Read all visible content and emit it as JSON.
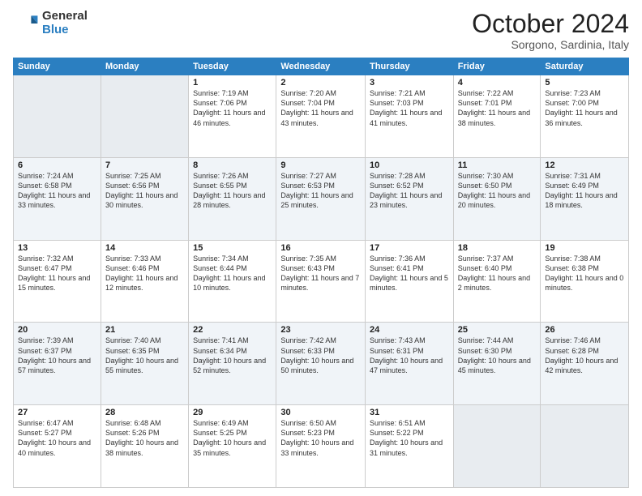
{
  "logo": {
    "general": "General",
    "blue": "Blue"
  },
  "header": {
    "month": "October 2024",
    "location": "Sorgono, Sardinia, Italy"
  },
  "weekdays": [
    "Sunday",
    "Monday",
    "Tuesday",
    "Wednesday",
    "Thursday",
    "Friday",
    "Saturday"
  ],
  "weeks": [
    [
      null,
      null,
      {
        "day": "1",
        "sunrise": "Sunrise: 7:19 AM",
        "sunset": "Sunset: 7:06 PM",
        "daylight": "Daylight: 11 hours and 46 minutes."
      },
      {
        "day": "2",
        "sunrise": "Sunrise: 7:20 AM",
        "sunset": "Sunset: 7:04 PM",
        "daylight": "Daylight: 11 hours and 43 minutes."
      },
      {
        "day": "3",
        "sunrise": "Sunrise: 7:21 AM",
        "sunset": "Sunset: 7:03 PM",
        "daylight": "Daylight: 11 hours and 41 minutes."
      },
      {
        "day": "4",
        "sunrise": "Sunrise: 7:22 AM",
        "sunset": "Sunset: 7:01 PM",
        "daylight": "Daylight: 11 hours and 38 minutes."
      },
      {
        "day": "5",
        "sunrise": "Sunrise: 7:23 AM",
        "sunset": "Sunset: 7:00 PM",
        "daylight": "Daylight: 11 hours and 36 minutes."
      }
    ],
    [
      {
        "day": "6",
        "sunrise": "Sunrise: 7:24 AM",
        "sunset": "Sunset: 6:58 PM",
        "daylight": "Daylight: 11 hours and 33 minutes."
      },
      {
        "day": "7",
        "sunrise": "Sunrise: 7:25 AM",
        "sunset": "Sunset: 6:56 PM",
        "daylight": "Daylight: 11 hours and 30 minutes."
      },
      {
        "day": "8",
        "sunrise": "Sunrise: 7:26 AM",
        "sunset": "Sunset: 6:55 PM",
        "daylight": "Daylight: 11 hours and 28 minutes."
      },
      {
        "day": "9",
        "sunrise": "Sunrise: 7:27 AM",
        "sunset": "Sunset: 6:53 PM",
        "daylight": "Daylight: 11 hours and 25 minutes."
      },
      {
        "day": "10",
        "sunrise": "Sunrise: 7:28 AM",
        "sunset": "Sunset: 6:52 PM",
        "daylight": "Daylight: 11 hours and 23 minutes."
      },
      {
        "day": "11",
        "sunrise": "Sunrise: 7:30 AM",
        "sunset": "Sunset: 6:50 PM",
        "daylight": "Daylight: 11 hours and 20 minutes."
      },
      {
        "day": "12",
        "sunrise": "Sunrise: 7:31 AM",
        "sunset": "Sunset: 6:49 PM",
        "daylight": "Daylight: 11 hours and 18 minutes."
      }
    ],
    [
      {
        "day": "13",
        "sunrise": "Sunrise: 7:32 AM",
        "sunset": "Sunset: 6:47 PM",
        "daylight": "Daylight: 11 hours and 15 minutes."
      },
      {
        "day": "14",
        "sunrise": "Sunrise: 7:33 AM",
        "sunset": "Sunset: 6:46 PM",
        "daylight": "Daylight: 11 hours and 12 minutes."
      },
      {
        "day": "15",
        "sunrise": "Sunrise: 7:34 AM",
        "sunset": "Sunset: 6:44 PM",
        "daylight": "Daylight: 11 hours and 10 minutes."
      },
      {
        "day": "16",
        "sunrise": "Sunrise: 7:35 AM",
        "sunset": "Sunset: 6:43 PM",
        "daylight": "Daylight: 11 hours and 7 minutes."
      },
      {
        "day": "17",
        "sunrise": "Sunrise: 7:36 AM",
        "sunset": "Sunset: 6:41 PM",
        "daylight": "Daylight: 11 hours and 5 minutes."
      },
      {
        "day": "18",
        "sunrise": "Sunrise: 7:37 AM",
        "sunset": "Sunset: 6:40 PM",
        "daylight": "Daylight: 11 hours and 2 minutes."
      },
      {
        "day": "19",
        "sunrise": "Sunrise: 7:38 AM",
        "sunset": "Sunset: 6:38 PM",
        "daylight": "Daylight: 11 hours and 0 minutes."
      }
    ],
    [
      {
        "day": "20",
        "sunrise": "Sunrise: 7:39 AM",
        "sunset": "Sunset: 6:37 PM",
        "daylight": "Daylight: 10 hours and 57 minutes."
      },
      {
        "day": "21",
        "sunrise": "Sunrise: 7:40 AM",
        "sunset": "Sunset: 6:35 PM",
        "daylight": "Daylight: 10 hours and 55 minutes."
      },
      {
        "day": "22",
        "sunrise": "Sunrise: 7:41 AM",
        "sunset": "Sunset: 6:34 PM",
        "daylight": "Daylight: 10 hours and 52 minutes."
      },
      {
        "day": "23",
        "sunrise": "Sunrise: 7:42 AM",
        "sunset": "Sunset: 6:33 PM",
        "daylight": "Daylight: 10 hours and 50 minutes."
      },
      {
        "day": "24",
        "sunrise": "Sunrise: 7:43 AM",
        "sunset": "Sunset: 6:31 PM",
        "daylight": "Daylight: 10 hours and 47 minutes."
      },
      {
        "day": "25",
        "sunrise": "Sunrise: 7:44 AM",
        "sunset": "Sunset: 6:30 PM",
        "daylight": "Daylight: 10 hours and 45 minutes."
      },
      {
        "day": "26",
        "sunrise": "Sunrise: 7:46 AM",
        "sunset": "Sunset: 6:28 PM",
        "daylight": "Daylight: 10 hours and 42 minutes."
      }
    ],
    [
      {
        "day": "27",
        "sunrise": "Sunrise: 6:47 AM",
        "sunset": "Sunset: 5:27 PM",
        "daylight": "Daylight: 10 hours and 40 minutes."
      },
      {
        "day": "28",
        "sunrise": "Sunrise: 6:48 AM",
        "sunset": "Sunset: 5:26 PM",
        "daylight": "Daylight: 10 hours and 38 minutes."
      },
      {
        "day": "29",
        "sunrise": "Sunrise: 6:49 AM",
        "sunset": "Sunset: 5:25 PM",
        "daylight": "Daylight: 10 hours and 35 minutes."
      },
      {
        "day": "30",
        "sunrise": "Sunrise: 6:50 AM",
        "sunset": "Sunset: 5:23 PM",
        "daylight": "Daylight: 10 hours and 33 minutes."
      },
      {
        "day": "31",
        "sunrise": "Sunrise: 6:51 AM",
        "sunset": "Sunset: 5:22 PM",
        "daylight": "Daylight: 10 hours and 31 minutes."
      },
      null,
      null
    ]
  ]
}
